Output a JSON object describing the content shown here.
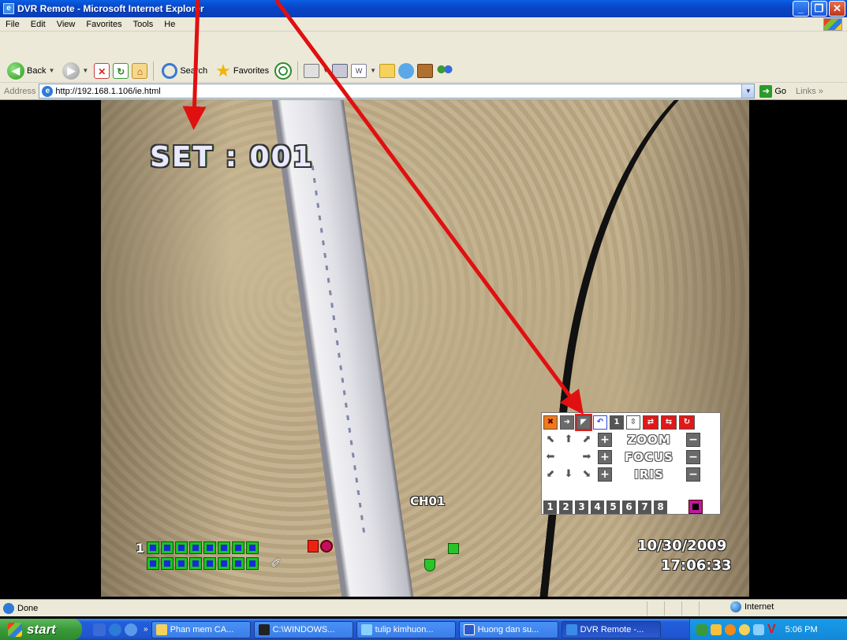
{
  "window": {
    "title": "DVR Remote - Microsoft Internet Explorer",
    "minimize": "_",
    "maximize": "❐",
    "close": "✕"
  },
  "menu": {
    "items": [
      "File",
      "Edit",
      "View",
      "Favorites",
      "Tools",
      "He"
    ]
  },
  "toolbar": {
    "back": "Back",
    "search": "Search",
    "favorites": "Favorites"
  },
  "address": {
    "label": "Address",
    "url": "http://192.168.1.106/ie.html",
    "go": "Go",
    "links": "Links »"
  },
  "osd": {
    "set_label": "SET : 001",
    "channel": "CH01",
    "date": "10/30/2009",
    "time": "17:06:33",
    "channel_group_number": "1"
  },
  "ptz": {
    "preset_number": "1",
    "zoom": "ZOOM",
    "focus": "FOCUS",
    "iris": "IRIS",
    "channels": [
      "1",
      "2",
      "3",
      "4",
      "5",
      "6",
      "7",
      "8"
    ]
  },
  "status": {
    "text": "Done",
    "zone": "Internet"
  },
  "taskbar": {
    "start": "start",
    "items": [
      {
        "label": "Phan mem CA...",
        "active": false
      },
      {
        "label": "C:\\WINDOWS...",
        "active": false
      },
      {
        "label": "tulip kimhuon...",
        "active": false
      },
      {
        "label": "Huong dan su...",
        "active": false
      },
      {
        "label": "DVR Remote -...",
        "active": true
      }
    ],
    "clock": "5:06 PM",
    "tray_letter": "V"
  },
  "colors": {
    "annotation_arrow": "#e01010",
    "xp_blue": "#0a46c8",
    "osd_green": "#1cc41c"
  }
}
